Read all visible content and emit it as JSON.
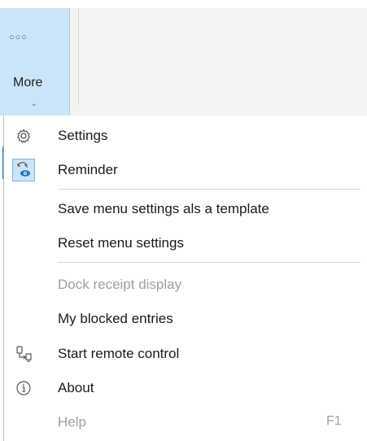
{
  "ribbon": {
    "more_dots": "○○○",
    "more_label": "More",
    "more_chevron": "⌄"
  },
  "menu": {
    "items": [
      {
        "label": "Settings",
        "icon": "gear-icon"
      },
      {
        "label": "Reminder",
        "icon": "reminder-icon"
      },
      {
        "label": "Save menu settings als a template"
      },
      {
        "label": "Reset menu settings"
      },
      {
        "label": "Dock receipt display",
        "disabled": true
      },
      {
        "label": "My blocked entries"
      },
      {
        "label": "Start remote control",
        "icon": "remote-control-icon"
      },
      {
        "label": "About",
        "icon": "info-icon"
      },
      {
        "label": "Help",
        "shortcut": "F1",
        "disabled": true
      }
    ]
  },
  "colors": {
    "accent": "#1e74c2",
    "selected_bg": "#cce4f7",
    "disabled_text": "#a0a0a0"
  }
}
